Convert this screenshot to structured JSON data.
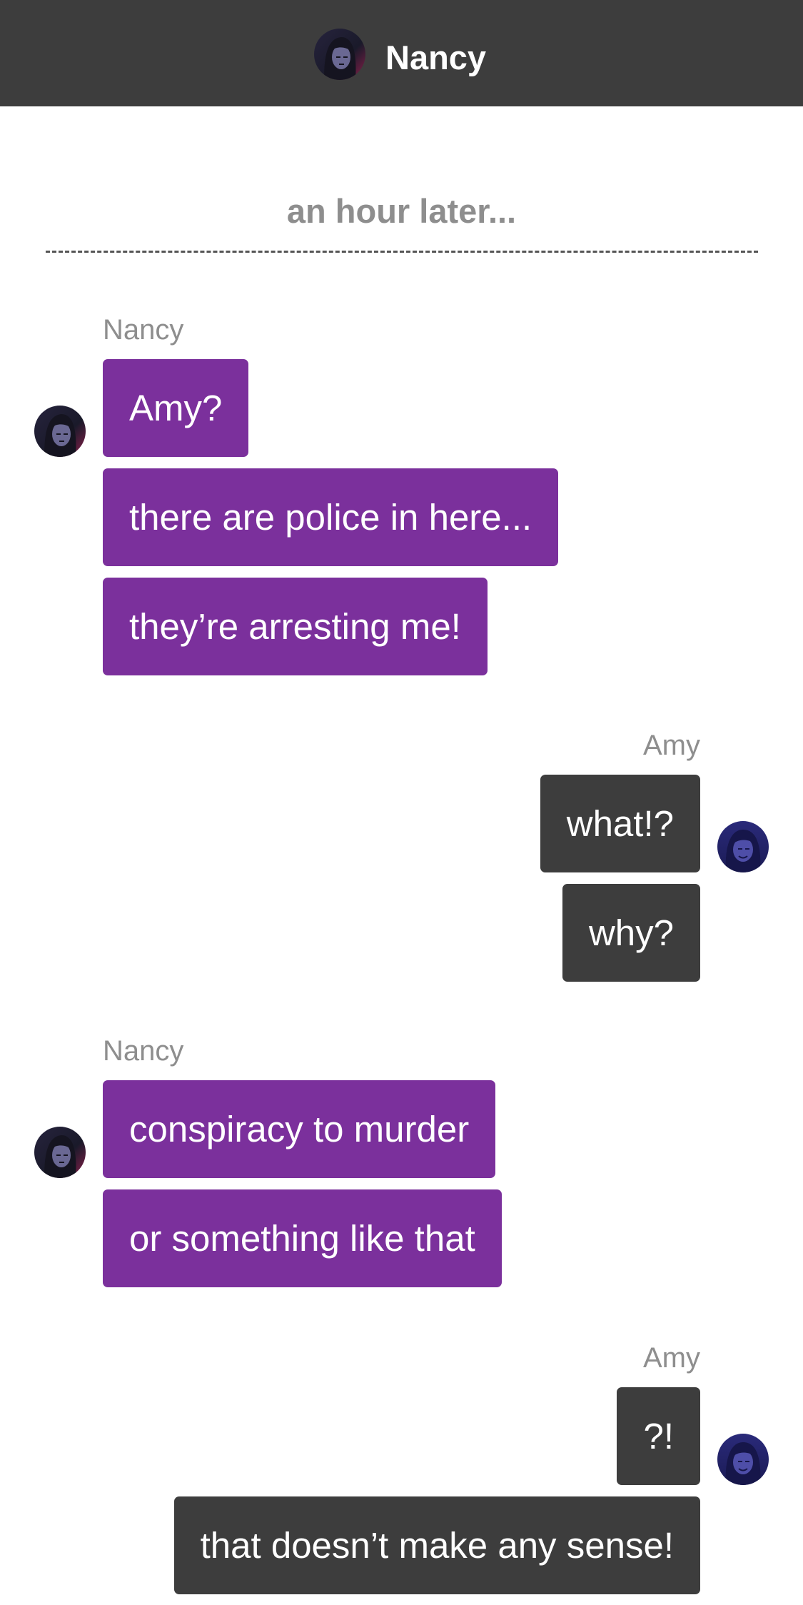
{
  "header": {
    "title": "Nancy",
    "avatar_icon": "nancy-avatar-icon"
  },
  "divider": {
    "label": "an hour later..."
  },
  "conversation": [
    {
      "sender": "Nancy",
      "messages": [
        "Amy?",
        "there are police in here...",
        "they’re arresting me!"
      ]
    },
    {
      "sender": "Amy",
      "messages": [
        "what!?",
        "why?"
      ]
    },
    {
      "sender": "Nancy",
      "messages": [
        "conspiracy to murder",
        "or something like that"
      ]
    },
    {
      "sender": "Amy",
      "messages": [
        "?!",
        "that doesn’t make any sense!"
      ]
    }
  ],
  "colors": {
    "header_bg": "#3d3d3d",
    "nancy_bubble": "#7b309c",
    "amy_bubble": "#3d3d3d",
    "muted_text": "#8e8e8e"
  }
}
